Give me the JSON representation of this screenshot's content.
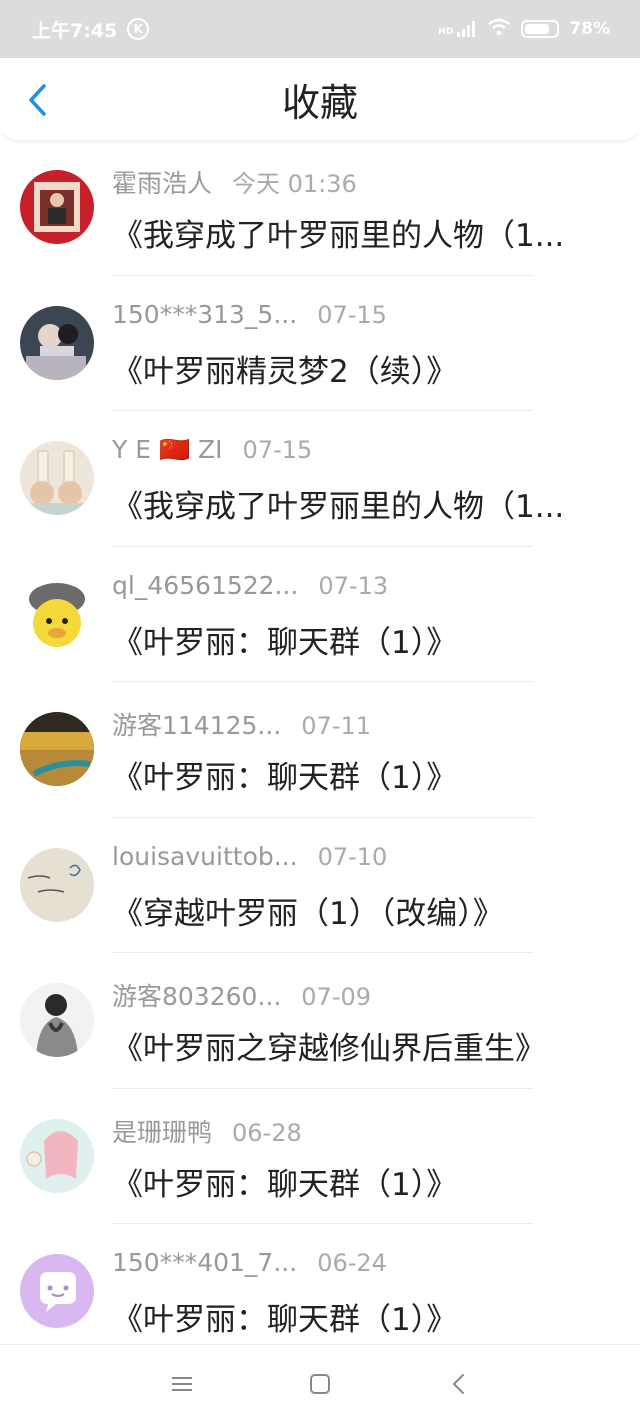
{
  "status_bar": {
    "time": "上午7:45",
    "k_badge": "K",
    "network": "HD",
    "battery": "78%",
    "battery_level": 0.78
  },
  "header": {
    "title": "收藏",
    "back_icon": "chevron-left-icon"
  },
  "colors": {
    "accent": "#1f8fe8",
    "status_bar": "#dcdcdc",
    "meta_text": "#999999",
    "title_text": "#222222"
  },
  "items": [
    {
      "author": "霍雨浩人",
      "time": "今天 01:36",
      "title": "《我穿成了叶罗丽里的人物（1..."
    },
    {
      "author": "150***313_5...",
      "time": "07-15",
      "title": "《叶罗丽精灵梦2（续）》"
    },
    {
      "author": "Y E 🇨🇳 ZI",
      "time": "07-15",
      "title": "《我穿成了叶罗丽里的人物（1..."
    },
    {
      "author": "ql_46561522...",
      "time": "07-13",
      "title": "《叶罗丽：聊天群（1）》"
    },
    {
      "author": "游客114125...",
      "time": "07-11",
      "title": "《叶罗丽：聊天群（1）》"
    },
    {
      "author": "louisavuittob...",
      "time": "07-10",
      "title": "《穿越叶罗丽（1）（改编）》"
    },
    {
      "author": "游客803260...",
      "time": "07-09",
      "title": "《叶罗丽之穿越修仙界后重生》"
    },
    {
      "author": "是珊珊鸭",
      "time": "06-28",
      "title": "《叶罗丽：聊天群（1）》"
    },
    {
      "author": "150***401_7...",
      "time": "06-24",
      "title": "《叶罗丽：聊天群（1）》"
    }
  ],
  "nav_bar": {
    "icons": [
      "menu-icon",
      "home-square-icon",
      "back-triangle-icon"
    ]
  }
}
